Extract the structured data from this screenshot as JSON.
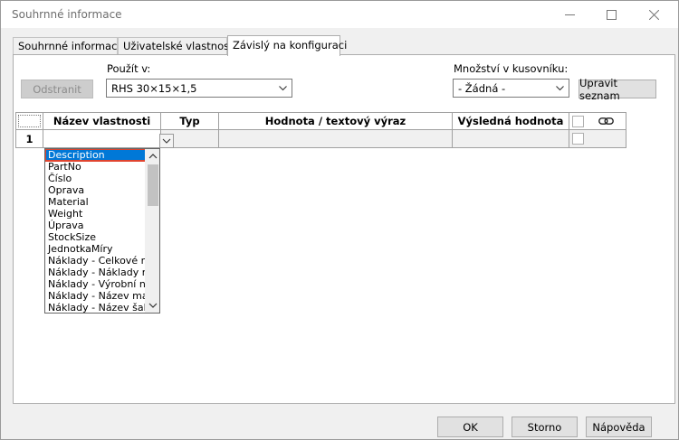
{
  "window": {
    "title": "Souhrnné informace"
  },
  "tabs": [
    {
      "label": "Souhrnné informace"
    },
    {
      "label": "Uživatelské vlastnosti"
    },
    {
      "label": "Závislý na konfiguraci",
      "active": true
    }
  ],
  "toolbar": {
    "delete_label": "Odstranit",
    "used_in_label": "Použít v:",
    "used_in_value": "RHS 30×15×1,5",
    "bom_qty_label": "Množství v kusovníku:",
    "bom_qty_value": "- Žádná -",
    "edit_list_label": "Upravit seznam"
  },
  "grid": {
    "columns": [
      "Název vlastnosti",
      "Typ",
      "Hodnota / textový výraz",
      "Výsledná hodnota"
    ],
    "rows": [
      {
        "number": "1",
        "property": "",
        "type": "",
        "value": "",
        "result": ""
      }
    ]
  },
  "dropdown": {
    "items": [
      "Description",
      "PartNo",
      "Číslo",
      "Oprava",
      "Material",
      "Weight",
      "Úprava",
      "StockSize",
      "JednotkaMíry",
      "Náklady - Celkové ná",
      "Náklady - Náklady na",
      "Náklady - Výrobní ná",
      "Náklady - Název mate",
      "Náklady - Název šabl"
    ],
    "selected_index": 0
  },
  "footer": {
    "ok_label": "OK",
    "cancel_label": "Storno",
    "help_label": "Nápověda"
  },
  "colors": {
    "selection": "#0078d7",
    "highlight_border": "#e0442f"
  }
}
